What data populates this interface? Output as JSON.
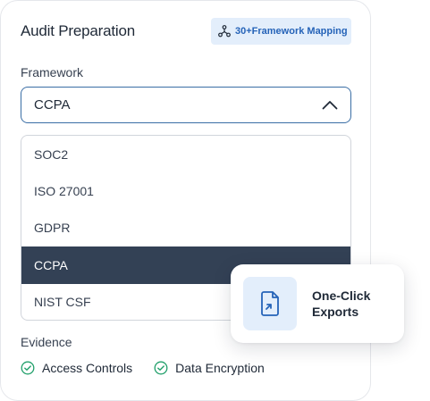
{
  "card": {
    "title": "Audit Preparation",
    "badge_label": "30+Framework Mapping",
    "framework_label": "Framework",
    "selected_value": "CCPA",
    "options": [
      "SOC2",
      "ISO 27001",
      "GDPR",
      "CCPA",
      "NIST CSF"
    ],
    "selected_index": 3,
    "evidence_label": "Evidence",
    "evidence_items": [
      "Access Controls",
      "Data Encryption"
    ]
  },
  "popup": {
    "label": "One-Click Exports",
    "icon": "file-export-icon"
  },
  "colors": {
    "accent": "#2563b8",
    "accent_bg": "#e3eefb",
    "selected_bg": "#334155",
    "check": "#22a06b"
  }
}
